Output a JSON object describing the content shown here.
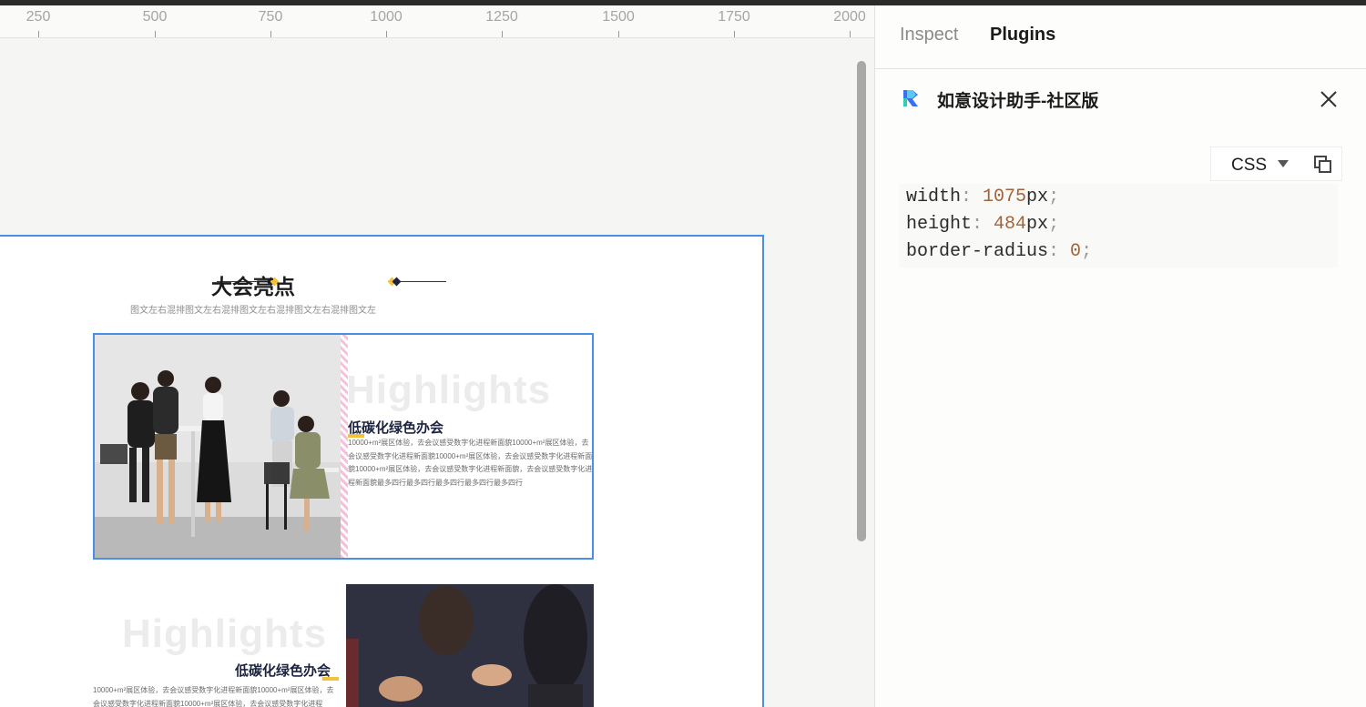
{
  "ruler": {
    "ticks": [
      "250",
      "500",
      "750",
      "1000",
      "1250",
      "1500",
      "1750",
      "2000"
    ]
  },
  "frame": {
    "section_title": "大会亮点",
    "section_subtitle": "图文左右混排图文左右混排图文左右混排图文左右混排图文左",
    "card1": {
      "watermark": "Highlights",
      "title": "低碳化绿色办会",
      "body": "10000+m²展区体验，去会议感受数字化进程新面貌10000+m²展区体验，去会议感受数字化进程新面貌10000+m²展区体验，去会议感受数字化进程新面貌10000+m²展区体验，去会议感受数字化进程新面貌，去会议感受数字化进程新面貌最多四行最多四行最多四行最多四行最多四行"
    },
    "card2": {
      "watermark": "Highlights",
      "title": "低碳化绿色办会",
      "body": "10000+m²展区体验，去会议感受数字化进程新面貌10000+m²展区体验，去会议感受数字化进程新面貌10000+m²展区体验，去会议感受数字化进程"
    },
    "colors": {
      "accent_yellow": "#f2c33a",
      "selection_blue": "#4a90e2"
    }
  },
  "panel": {
    "tabs": [
      {
        "label": "Inspect",
        "active": false
      },
      {
        "label": "Plugins",
        "active": true
      }
    ],
    "plugin_name": "如意设计助手-社区版",
    "format_select": "CSS",
    "code": [
      {
        "prop": "width",
        "value": "1075",
        "unit": "px"
      },
      {
        "prop": "height",
        "value": "484",
        "unit": "px"
      },
      {
        "prop": "border-radius",
        "value": "0",
        "unit": ""
      }
    ],
    "icons": {
      "logo": "plugin-logo-icon",
      "close": "close-icon",
      "copy": "copy-icon",
      "caret": "chevron-down-icon"
    }
  }
}
